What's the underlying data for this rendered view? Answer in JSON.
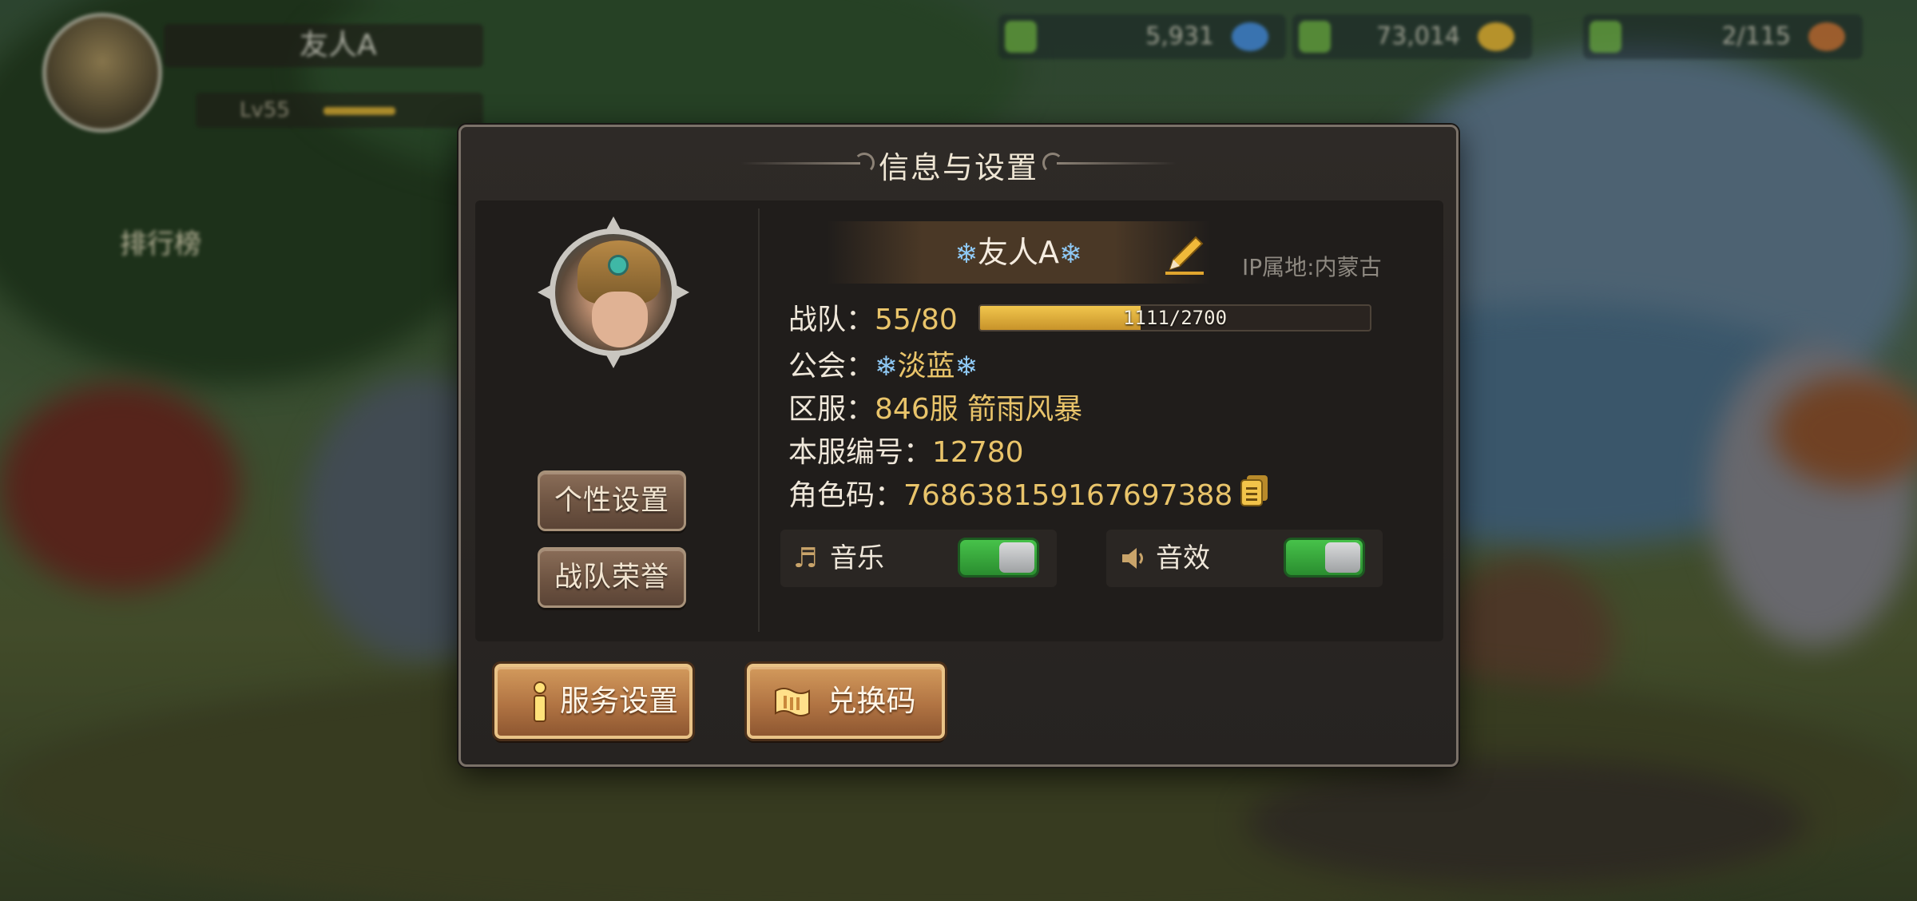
{
  "hud": {
    "player_name": "友人A",
    "player_level": "Lv55",
    "currencies": [
      {
        "value": "5,931",
        "icon": "diamond-icon"
      },
      {
        "value": "73,014",
        "icon": "gold-coin-icon"
      },
      {
        "value": "2/115",
        "icon": "meat-icon"
      }
    ],
    "leaderboard_label": "排行榜"
  },
  "dialog": {
    "title": "信息与设置",
    "side_buttons": {
      "personalize": "个性设置",
      "team_honor": "战队荣誉"
    },
    "profile": {
      "name": "友人A",
      "ip_location": "IP属地:内蒙古",
      "team_label": "战队：",
      "team_level": "55/80",
      "xp_text": "1111/2700",
      "xp_progress": 0.4115,
      "guild_label": "公会：",
      "guild_name": "淡蓝",
      "server_label": "区服：",
      "server_name": "846服 箭雨风暴",
      "server_id_label": "本服编号：",
      "server_id": "12780",
      "role_code_label": "角色码：",
      "role_code": "768638159167697388"
    },
    "settings": {
      "music_label": "音乐",
      "music_on": true,
      "sfx_label": "音效",
      "sfx_on": true
    },
    "bottom_buttons": {
      "service": "服务设置",
      "redeem": "兑换码"
    }
  },
  "colors": {
    "accent_gold": "#e9c46a",
    "toggle_on": "#3aaa3e",
    "snowflake": "#8fc9f5"
  }
}
